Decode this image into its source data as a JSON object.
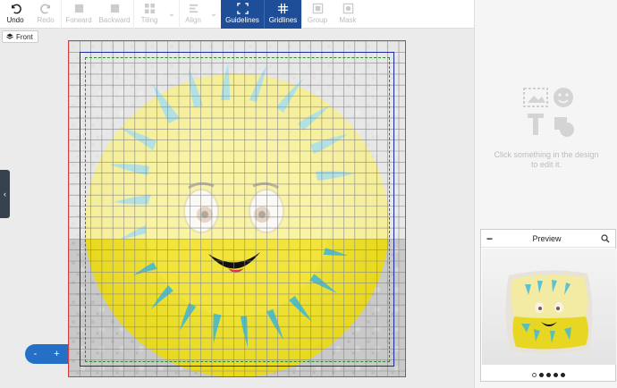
{
  "toolbar": {
    "undo": "Undo",
    "redo": "Redo",
    "forward": "Forward",
    "backward": "Backward",
    "tiling": "Tiling",
    "align": "Align",
    "guidelines": "Guidelines",
    "gridlines": "Gridlines",
    "group": "Group",
    "mask": "Mask"
  },
  "side": {
    "front_label": "Front"
  },
  "panel": {
    "hint": "Click something in the design to edit it."
  },
  "zoom": {
    "minus": "-",
    "plus": "+"
  },
  "preview": {
    "title": "Preview",
    "active_dot": 0,
    "dot_count": 5
  },
  "colors": {
    "active": "#1f4e99",
    "bleed": "#1b2a9c",
    "safe": "#2b8a2b",
    "trim": "#d04040"
  }
}
